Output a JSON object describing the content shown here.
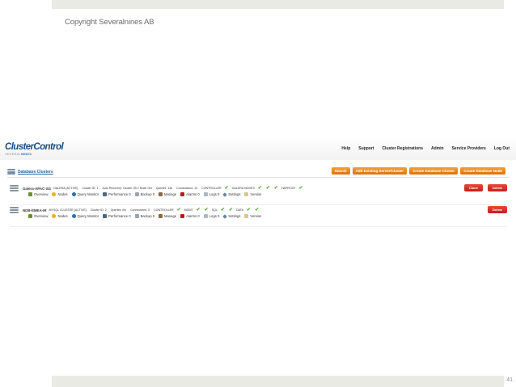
{
  "slide": {
    "copyright": "Copyright Severalnines AB",
    "page_number": "41"
  },
  "app": {
    "logo_main": "ClusterControl",
    "logo_sub_prefix": "SEVERAL",
    "logo_sub_suffix": "NINES",
    "nav": [
      "Help",
      "Support",
      "Cluster Registrations",
      "Admin",
      "Service Providers",
      "Log Out"
    ],
    "section_title": "Database Clusters",
    "toolbar": {
      "search": "Search",
      "add_existing": "Add Existing Server/Cluster",
      "create_cluster": "Create Database Cluster",
      "create_node": "Create Database Node"
    },
    "actions": {
      "overview": "Overview",
      "nodes": "Nodes",
      "query_monitor": "Query Monitor",
      "manage": "Manage",
      "settings": "Settings",
      "version": "Version"
    },
    "clusters": [
      {
        "name": "Galera-APAC-SG",
        "type": "GALERA [ACTIVE]",
        "cluster_id": "Cluster ID: 1",
        "auto_recovery": "Auto Recovery: Cluster ON / Node ON",
        "queries": "Queries: 13s",
        "connections": "Connections: 13",
        "controller": "CONTROLLER",
        "nodes_label": "GALERA NODES",
        "gateway": "HAPROXY",
        "performance": "Performance 0",
        "backup": "Backup 0",
        "alarms": "Alarms 0",
        "logs": "Logs 0",
        "clone": "Clone",
        "delete": "Delete"
      },
      {
        "name": "NDB-EMEA-IR",
        "type": "MYSQL CLUSTER [ACTIVE]",
        "cluster_id": "Cluster ID: 2",
        "queries": "Queries: 0/s",
        "connections": "Connections: 3",
        "controller": "CONTROLLER",
        "mgmt_label": "MGMT",
        "sql_label": "SQL",
        "data_label": "DATA",
        "performance": "Performance 0",
        "backup": "Backup 0",
        "alarms": "Alarms 0",
        "logs": "Logs 0",
        "delete": "Delete"
      }
    ]
  }
}
